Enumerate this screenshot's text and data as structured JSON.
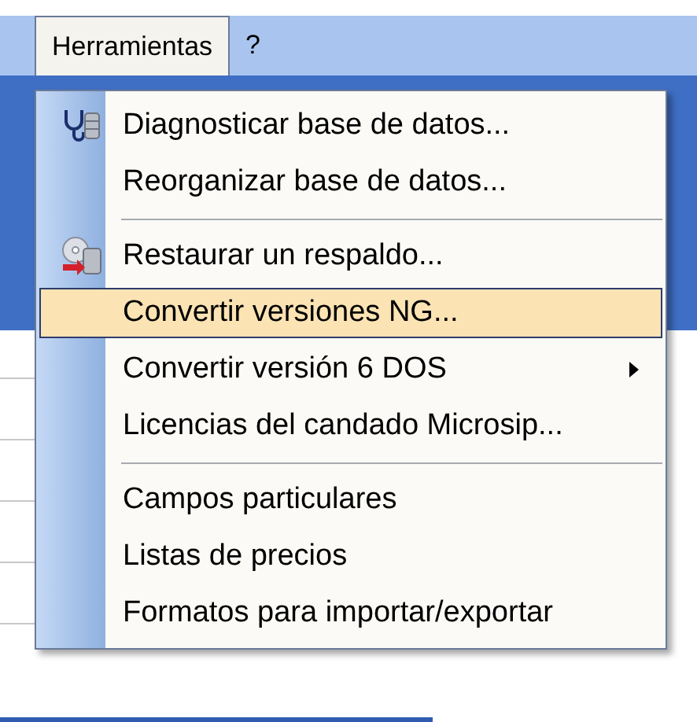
{
  "menu_bar": [
    {
      "label": "Herramientas",
      "selected": true
    },
    {
      "label": "?",
      "selected": false
    }
  ],
  "menu": [
    {
      "kind": "item",
      "label": "Diagnosticar base de datos...",
      "has_icon": true,
      "selected": false,
      "submenu": false
    },
    {
      "kind": "item",
      "label": "Reorganizar base de datos...",
      "has_icon": false,
      "selected": false,
      "submenu": false
    },
    {
      "kind": "separator"
    },
    {
      "kind": "item",
      "label": "Restaurar un respaldo...",
      "has_icon": true,
      "selected": false,
      "submenu": false
    },
    {
      "kind": "item",
      "label": "Convertir versiones NG...",
      "has_icon": false,
      "selected": true,
      "submenu": false
    },
    {
      "kind": "item",
      "label": "Convertir versión 6 DOS",
      "has_icon": false,
      "selected": false,
      "submenu": true
    },
    {
      "kind": "item",
      "label": "Licencias del candado Microsip...",
      "has_icon": false,
      "selected": false,
      "submenu": false
    },
    {
      "kind": "separator"
    },
    {
      "kind": "item",
      "label": "Campos particulares",
      "has_icon": false,
      "selected": false,
      "submenu": false
    },
    {
      "kind": "item",
      "label": "Listas de precios",
      "has_icon": false,
      "selected": false,
      "submenu": false
    },
    {
      "kind": "item",
      "label": "Formatos para importar/exportar",
      "has_icon": false,
      "selected": false,
      "submenu": false
    }
  ]
}
